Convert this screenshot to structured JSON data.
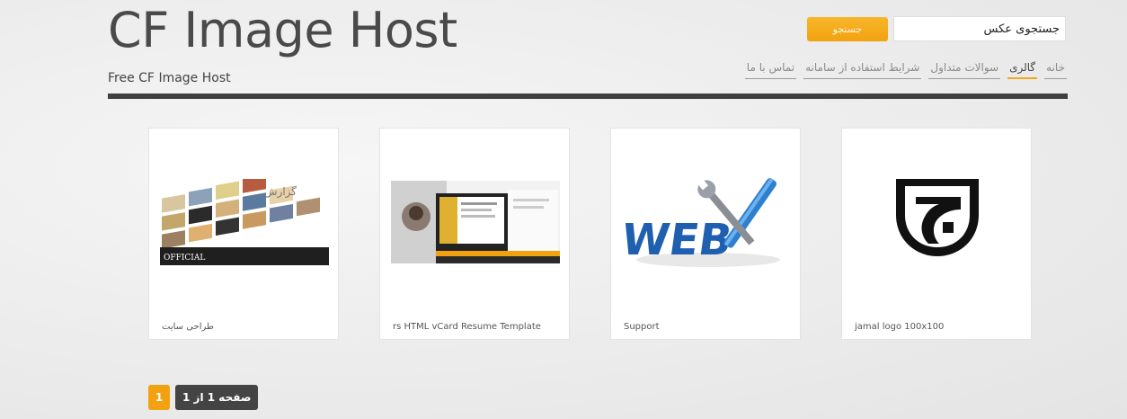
{
  "header": {
    "site_title": "CF Image Host",
    "tagline": "Free CF Image Host"
  },
  "search": {
    "button_label": "جستجو",
    "input_value": "جستجوی عکس"
  },
  "nav": {
    "items": [
      {
        "label": "خانه",
        "active": false
      },
      {
        "label": "گالری",
        "active": true
      },
      {
        "label": "سوالات متداول",
        "active": false
      },
      {
        "label": "شرایط استفاده از سامانه",
        "active": false
      },
      {
        "label": "تماس با ما",
        "active": false
      }
    ]
  },
  "gallery": {
    "items": [
      {
        "caption": "طراحی سایت",
        "thumb_text": "گزارش",
        "thumb_sub": "OFFICIAL"
      },
      {
        "caption": "rs HTML vCard Resume Template"
      },
      {
        "caption": "Support",
        "thumb_text": "WEB"
      },
      {
        "caption": "jamal logo 100x100"
      }
    ]
  },
  "pager": {
    "current_page": "1",
    "info": "صفحه 1 از 1"
  },
  "colors": {
    "accent": "#f2a211",
    "dark_bar": "#3f3f3f"
  }
}
